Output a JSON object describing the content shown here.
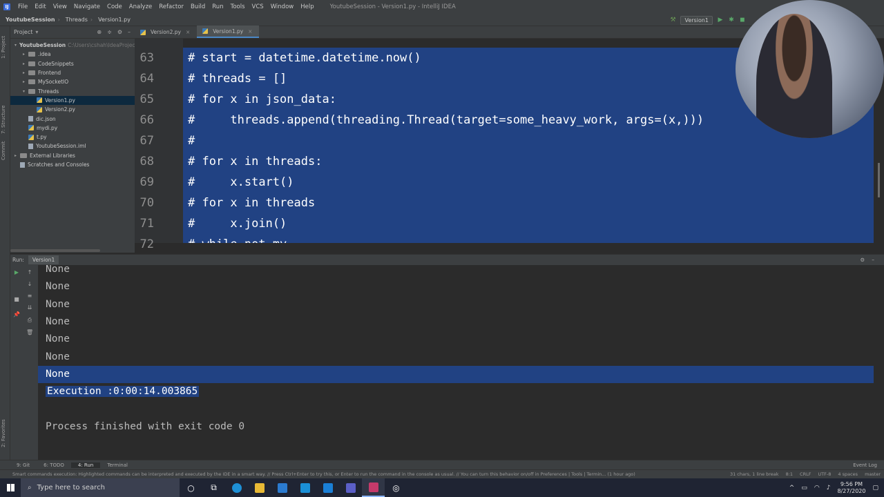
{
  "menubar": {
    "items": [
      "File",
      "Edit",
      "View",
      "Navigate",
      "Code",
      "Analyze",
      "Refactor",
      "Build",
      "Run",
      "Tools",
      "VCS",
      "Window",
      "Help"
    ],
    "window_title": "YoutubeSession - Version1.py - IntelliJ IDEA"
  },
  "navbar": {
    "crumbs": [
      "YoutubeSession",
      "Threads",
      "Version1.py"
    ],
    "run_config": "Version1"
  },
  "project": {
    "title": "Project",
    "rows": [
      {
        "label": "YoutubeSession",
        "extra": "C:\\Users\\cshah\\IdeaProjec",
        "depth": 0,
        "kind": "folder",
        "arrow": "▾"
      },
      {
        "label": ".idea",
        "depth": 1,
        "kind": "folder",
        "arrow": "▸"
      },
      {
        "label": "CodeSnippets",
        "depth": 1,
        "kind": "folder",
        "arrow": "▸"
      },
      {
        "label": "Frontend",
        "depth": 1,
        "kind": "folder",
        "arrow": "▸"
      },
      {
        "label": "MySocketIO",
        "depth": 1,
        "kind": "folder",
        "arrow": "▸"
      },
      {
        "label": "Threads",
        "depth": 1,
        "kind": "folder",
        "arrow": "▾"
      },
      {
        "label": "Version1.py",
        "depth": 2,
        "kind": "py",
        "arrow": "",
        "selected": true
      },
      {
        "label": "Version2.py",
        "depth": 2,
        "kind": "py",
        "arrow": ""
      },
      {
        "label": "dic.json",
        "depth": 1,
        "kind": "file",
        "arrow": ""
      },
      {
        "label": "mydi.py",
        "depth": 1,
        "kind": "py",
        "arrow": ""
      },
      {
        "label": "t.py",
        "depth": 1,
        "kind": "py",
        "arrow": ""
      },
      {
        "label": "YoutubeSession.iml",
        "depth": 1,
        "kind": "file",
        "arrow": ""
      },
      {
        "label": "External Libraries",
        "depth": 0,
        "kind": "folder",
        "arrow": "▸"
      },
      {
        "label": "Scratches and Consoles",
        "depth": 0,
        "kind": "file",
        "arrow": ""
      }
    ]
  },
  "left_strip": {
    "project_tab": "1: Project",
    "structure_tab": "7: Structure",
    "commit_tab": "Commit",
    "favorites_tab": "2: Favorites"
  },
  "editor": {
    "tabs": [
      {
        "label": "Version2.py",
        "active": false
      },
      {
        "label": "Version1.py",
        "active": true
      }
    ],
    "lines": [
      {
        "no": "63",
        "text": "# start = datetime.datetime.now()"
      },
      {
        "no": "64",
        "text": "# threads = []"
      },
      {
        "no": "65",
        "text": "# for x in json_data:"
      },
      {
        "no": "66",
        "text": "#     threads.append(threading.Thread(target=some_heavy_work, args=(x,)))"
      },
      {
        "no": "67",
        "text": "#"
      },
      {
        "no": "68",
        "text": "# for x in threads:"
      },
      {
        "no": "69",
        "text": "#     x.start()"
      },
      {
        "no": "70",
        "text": "# for x in threads"
      },
      {
        "no": "71",
        "text": "#     x.join()"
      },
      {
        "no": "72",
        "text": "# while not my"
      }
    ]
  },
  "run_panel": {
    "label": "Run:",
    "tab": "Version1",
    "output": [
      "None",
      "None",
      "None",
      "None",
      "None",
      "None",
      "None",
      "Execution :0:00:14.003865",
      "",
      "Process finished with exit code 0"
    ]
  },
  "bottom_bar": {
    "items": [
      "9: Git",
      "6: TODO",
      "4: Run",
      "Terminal"
    ],
    "event_log": "Event Log"
  },
  "status_bar": {
    "message": "Smart commands execution: Highlighted commands can be interpreted and executed by the IDE in a smart way. // Press Ctrl+Enter to try this, or Enter to run the command in the console as usual. // You can turn this behavior on/off in Preferences | Tools | Termin... (1 hour ago)",
    "selection": "31 chars, 1 line break",
    "position": "8:1",
    "line_sep": "CRLF",
    "encoding": "UTF-8",
    "indent": "4 spaces",
    "branch": "master"
  },
  "taskbar": {
    "search_placeholder": "Type here to search",
    "time": "9:56 PM",
    "date": "8/27/2020"
  },
  "colors": {
    "selection": "#214283",
    "editor_bg": "#2b2b2b",
    "panel_bg": "#3c3f41"
  }
}
